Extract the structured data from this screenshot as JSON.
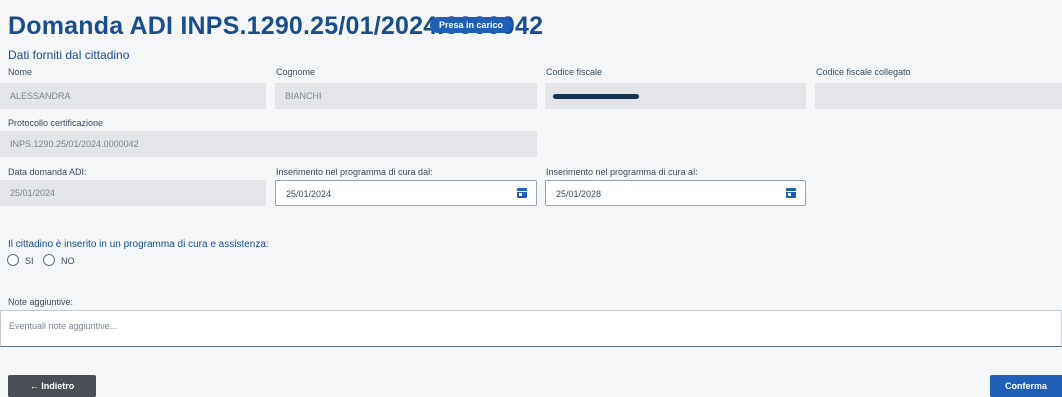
{
  "header": {
    "title": "Domanda ADI INPS.1290.25/01/2024.0000042",
    "status_badge": "Presa in carico"
  },
  "section_title": "Dati forniti dal cittadino",
  "fields": {
    "nome": {
      "label": "Nome",
      "value": "ALESSANDRA"
    },
    "cognome": {
      "label": "Cognome",
      "value": "BIANCHI"
    },
    "codice_fiscale": {
      "label": "Codice fiscale"
    },
    "cf_collegato": {
      "label": "Codice fiscale collegato",
      "value": ""
    },
    "protocollo": {
      "label": "Protocollo certificazione",
      "value": "INPS.1290.25/01/2024.0000042"
    },
    "data_domanda": {
      "label": "Data domanda ADI:",
      "value": "25/01/2024"
    },
    "programma_dal": {
      "label": "Inserimento nel programma di cura dal:",
      "value": "25/01/2024",
      "icon": "calendar-icon"
    },
    "programma_al": {
      "label": "Inserimento nel programma di cura al:",
      "value": "25/01/2028",
      "icon": "calendar-icon"
    }
  },
  "question": {
    "text": "Il cittadino è inserito in un programma di cura e assistenza:",
    "options": [
      "SI",
      "NO"
    ]
  },
  "notes": {
    "label": "Note aggiuntive:",
    "placeholder": "Eventuali note aggiuntive..."
  },
  "actions": {
    "back_label": "← Indietro",
    "confirm_label": "Conferma"
  },
  "colors": {
    "primary": "#1f5fb7",
    "title": "#1a4d8f",
    "back_button": "#4a4f55",
    "readonly_field": "#e3e5e8"
  }
}
